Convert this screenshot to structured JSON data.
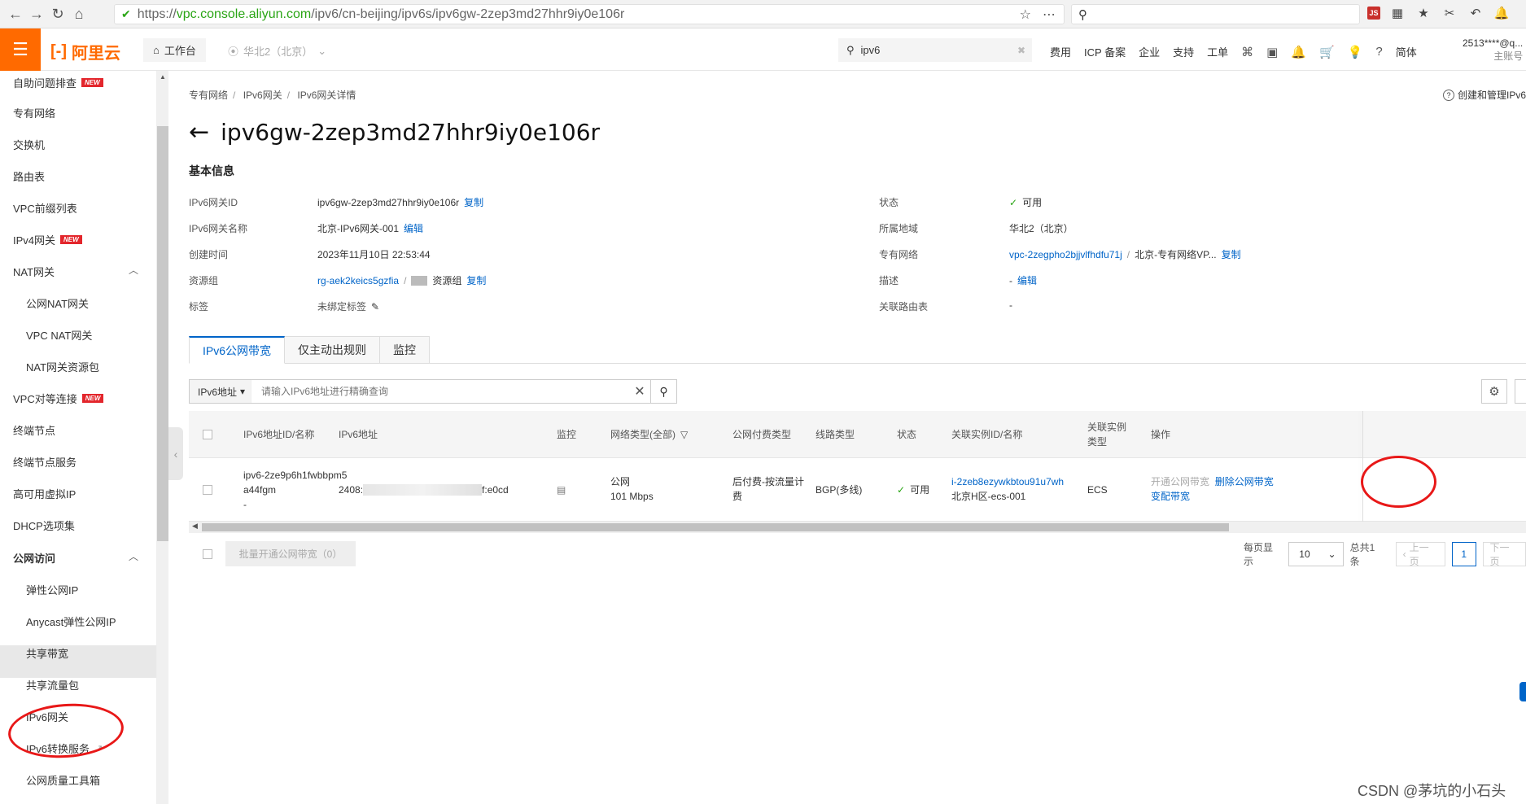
{
  "browser": {
    "url_prefix": "https://",
    "url_host": "vpc.console.aliyun.com",
    "url_path": "/ipv6/cn-beijing/ipv6s/ipv6gw-2zep3md27hhr9iy0e106r"
  },
  "topbar": {
    "logo": "阿里云",
    "workbench": "工作台",
    "region": "华北2（北京）",
    "search_value": "ipv6",
    "nav": [
      "费用",
      "ICP 备案",
      "企业",
      "支持",
      "工单"
    ],
    "lang": "简体",
    "account": "2513****@q...",
    "account_sub": "主账号"
  },
  "sidebar": {
    "items": [
      {
        "label": "自助问题排查",
        "badge": "NEW"
      },
      {
        "label": "专有网络"
      },
      {
        "label": "交换机"
      },
      {
        "label": "路由表"
      },
      {
        "label": "VPC前缀列表"
      },
      {
        "label": "IPv4网关",
        "badge": "NEW"
      },
      {
        "label": "NAT网关"
      },
      {
        "label": "公网NAT网关"
      },
      {
        "label": "VPC NAT网关"
      },
      {
        "label": "NAT网关资源包"
      },
      {
        "label": "VPC对等连接",
        "badge": "NEW"
      },
      {
        "label": "终端节点"
      },
      {
        "label": "终端节点服务"
      },
      {
        "label": "高可用虚拟IP"
      },
      {
        "label": "DHCP选项集"
      },
      {
        "label": "公网访问"
      },
      {
        "label": "弹性公网IP"
      },
      {
        "label": "Anycast弹性公网IP"
      },
      {
        "label": "共享带宽"
      },
      {
        "label": "共享流量包"
      },
      {
        "label": "IPv6网关"
      },
      {
        "label": "IPv6转换服务"
      },
      {
        "label": "公网质量工具箱"
      }
    ]
  },
  "breadcrumb": [
    "专有网络",
    "IPv6网关",
    "IPv6网关详情"
  ],
  "help_link": "创建和管理IPv6网",
  "page_title": "ipv6gw-2zep3md27hhr9iy0e106r",
  "section_title": "基本信息",
  "info": {
    "left": [
      {
        "label": "IPv6网关ID",
        "value": "ipv6gw-2zep3md27hhr9iy0e106r",
        "action": "复制"
      },
      {
        "label": "IPv6网关名称",
        "value": "北京-IPv6网关-001",
        "action": "编辑"
      },
      {
        "label": "创建时间",
        "value": "2023年11月10日 22:53:44"
      },
      {
        "label": "资源组",
        "value": "rg-aek2keics5gzfia",
        "value2": "资源组",
        "action": "复制"
      },
      {
        "label": "标签",
        "value": "未绑定标签"
      }
    ],
    "right": [
      {
        "label": "状态",
        "value": "可用"
      },
      {
        "label": "所属地域",
        "value": "华北2（北京）"
      },
      {
        "label": "专有网络",
        "value": "vpc-2zegpho2bjjvlfhdfu71j",
        "value2": "北京-专有网络VP...",
        "action": "复制"
      },
      {
        "label": "描述",
        "value": "-",
        "action": "编辑"
      },
      {
        "label": "关联路由表",
        "value": "-"
      }
    ]
  },
  "tabs": [
    "IPv6公网带宽",
    "仅主动出规则",
    "监控"
  ],
  "filter": {
    "select": "IPv6地址",
    "placeholder": "请输入IPv6地址进行精确查询"
  },
  "table": {
    "headers": [
      "IPv6地址ID/名称",
      "IPv6地址",
      "监控",
      "网络类型(全部)",
      "公网付费类型",
      "线路类型",
      "状态",
      "关联实例ID/名称",
      "关联实例类型",
      "操作"
    ],
    "row": {
      "id": "ipv6-2ze9p6h1fwbbpm5a44fgm",
      "name": "-",
      "ipv6_start": "2408:",
      "ipv6_end": "f:e0cd",
      "net_type": "公网",
      "bandwidth": "101 Mbps",
      "billing": "后付费-按流量计费",
      "line": "BGP(多线)",
      "status": "可用",
      "instance_id": "i-2zeb8ezywkbtou91u7wh",
      "instance_name": "北京H区-ecs-001",
      "instance_type": "ECS",
      "op1": "开通公网带宽",
      "op2": "删除公网带宽",
      "op3": "变配带宽"
    }
  },
  "footer": {
    "bulk_button": "批量开通公网带宽（0）",
    "per_page_label": "每页显示",
    "per_page": "10",
    "total": "总共1条",
    "prev": "上一页",
    "page": "1",
    "next": "下一页"
  },
  "watermark": "CSDN @茅坑的小石头"
}
